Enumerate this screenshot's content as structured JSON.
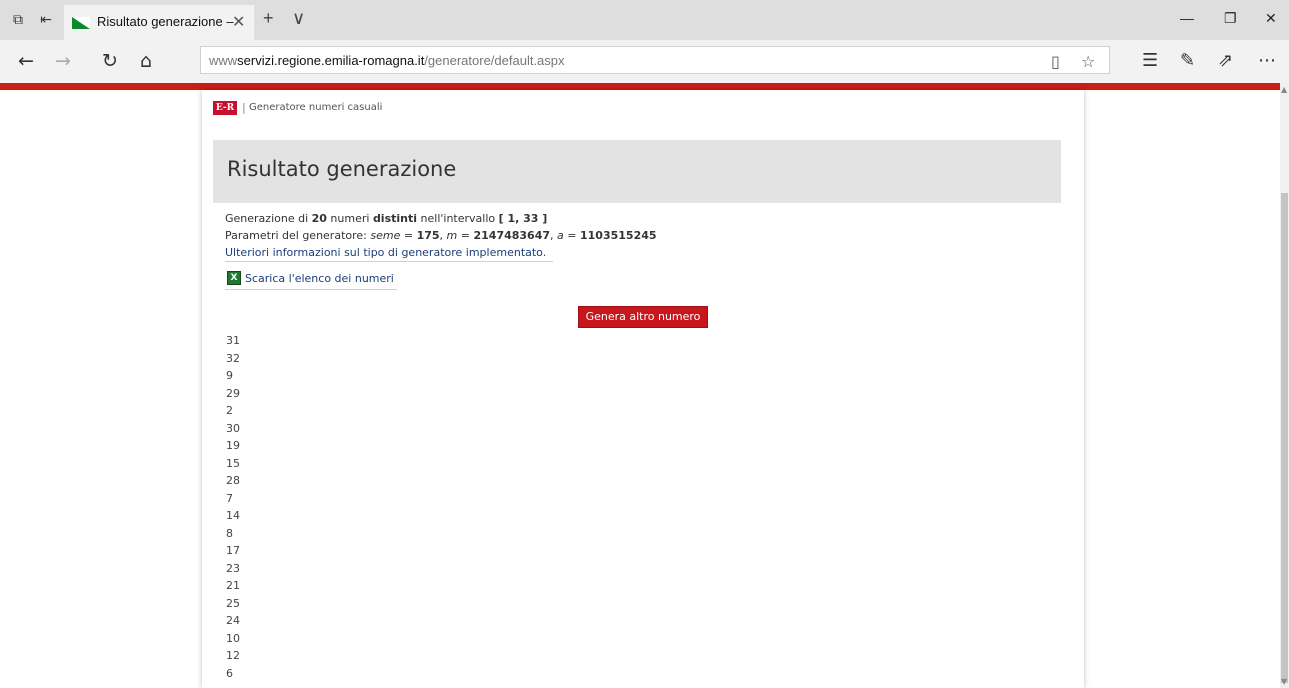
{
  "browser": {
    "tab_title": "Risultato generazione –",
    "tab_close": "✕",
    "new_tab": "+",
    "tab_menu": "∨",
    "url_prefix": "www",
    "url_domain": "servizi.regione.emilia-romagna.it",
    "url_path": "/generatore/default.aspx"
  },
  "site": {
    "logo_text": "E-R",
    "separator": "|",
    "site_name": "Generatore numeri casuali"
  },
  "result": {
    "title": "Risultato generazione",
    "line1_a": "Generazione di ",
    "line1_count": "20",
    "line1_b": " numeri ",
    "line1_distinct": "distinti",
    "line1_c": " nell'intervallo ",
    "line1_range": "[ 1, 33 ]",
    "line2_a": "Parametri del generatore: ",
    "line2_seed_label": "seme",
    "line2_eq1": " = ",
    "line2_seed": "175",
    "line2_sep1": ", ",
    "line2_m_label": "m",
    "line2_eq2": " = ",
    "line2_m": "2147483647",
    "line2_sep2": ", ",
    "line2_a_label": "a",
    "line2_eq3": " = ",
    "line2_a_value": "1103515245",
    "more_info_link": "Ulteriori informazioni sul tipo di generatore implementato.",
    "download_link": "Scarica l'elenco dei numeri",
    "generate_button": "Genera altro numero",
    "numbers": [
      "31",
      "32",
      "9",
      "29",
      "2",
      "30",
      "19",
      "15",
      "28",
      "7",
      "14",
      "8",
      "17",
      "23",
      "21",
      "25",
      "24",
      "10",
      "12",
      "6"
    ]
  },
  "colors": {
    "accent_red": "#cc1c16",
    "link_blue": "#1a3e7c",
    "excel_green": "#1e7a32"
  }
}
